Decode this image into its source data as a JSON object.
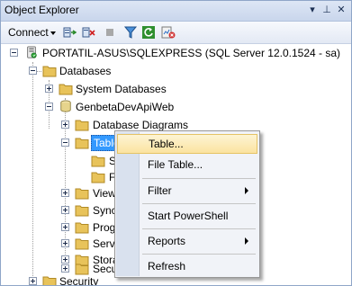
{
  "window": {
    "title": "Object Explorer",
    "controls": {
      "pin": "▾",
      "autohide": "⊥",
      "close": "✕"
    }
  },
  "toolbar": {
    "connect_label": "Connect",
    "icons": [
      "connect-object-explorer-icon",
      "disconnect-icon",
      "stop-icon",
      "filter-icon",
      "refresh-icon",
      "activity-monitor-icon"
    ]
  },
  "tree": {
    "server": "PORTATIL-ASUS\\SQLEXPRESS (SQL Server 12.0.1524 - sa)",
    "databases": "Databases",
    "system_databases": "System Databases",
    "database": "GenbetaDevApiWeb",
    "database_diagrams": "Database Diagrams",
    "tables": "Tables",
    "tables_child_1": "S",
    "tables_child_2": "F",
    "views": "Views",
    "synonyms": "Sync",
    "programmability": "Prog",
    "service_broker": "Servi",
    "storage": "Stora",
    "db_security": "Secu",
    "security": "Security"
  },
  "context_menu": {
    "items": [
      {
        "label": "Table...",
        "submenu": false,
        "highlighted": true
      },
      {
        "label": "File Table...",
        "submenu": false,
        "highlighted": false
      },
      {
        "label": "Filter",
        "submenu": true,
        "highlighted": false
      },
      {
        "label": "Start PowerShell",
        "submenu": false,
        "highlighted": false
      },
      {
        "label": "Reports",
        "submenu": true,
        "highlighted": false
      },
      {
        "label": "Refresh",
        "submenu": false,
        "highlighted": false
      }
    ]
  },
  "colors": {
    "selection": "#3399ff",
    "menu_highlight": "#fbe3a0",
    "folder": "#e8c35a",
    "title_bar": "#c9d6ec"
  }
}
